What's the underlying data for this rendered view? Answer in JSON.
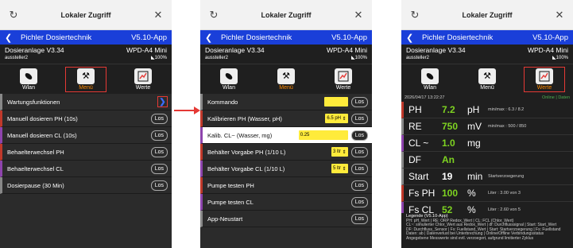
{
  "window": {
    "title": "Lokaler Zugriff"
  },
  "app": {
    "name": "Pichler Dosiertechnik",
    "version": "V5.10-App",
    "device": "Dosieranlage V3.34",
    "device_sub": "aussteller2",
    "model": "WPD-A4 Mini",
    "signal": "100%"
  },
  "nav": {
    "wlan": "Wlan",
    "menu": "Menü",
    "werte": "Werte"
  },
  "los": "Los",
  "screen1": {
    "items": [
      "Wartungsfunktionen",
      "Manuell dosieren PH (10s)",
      "Manuell dosieren CL (10s)",
      "Behaelterwechsel PH",
      "Behaelterwechsel CL",
      "Dosierpause (30 Min)"
    ]
  },
  "screen2": {
    "items": [
      "Kommando",
      "Kalibrieren PH (Wasser, pH)",
      "Kalib. CL~ (Wasser, mg)",
      "Behälter Vorgabe PH (1/10 L)",
      "Behälter Vorgabe CL (1/10 L)",
      "Pumpe testen PH",
      "Pumpe testen CL",
      "App-Neustart"
    ],
    "cal_ph": "6.5 pH",
    "cal_cl": "0.25",
    "vol_ph": "3 ltr",
    "vol_cl": "5 ltr"
  },
  "screen3": {
    "timestamp": "2026/04/17 13:22:27",
    "status": "Online | Daten",
    "rows": [
      {
        "name": "PH",
        "value": "7.2",
        "unit": "pH",
        "extra": "min/max : 6.3 / 8.2"
      },
      {
        "name": "RE",
        "value": "750",
        "unit": "mV",
        "extra": "min/max : 500 / 850"
      },
      {
        "name": "CL ~",
        "value": "1.0",
        "unit": "mg",
        "extra": ""
      },
      {
        "name": "DF",
        "value": "An",
        "unit": "",
        "extra": ""
      },
      {
        "name": "Start",
        "value": "19",
        "unit": "min",
        "extra": "Startverzoegerung"
      },
      {
        "name": "Fs PH",
        "value": "100",
        "unit": "%",
        "extra": "Liter : 3.00 von 3"
      },
      {
        "name": "Fs CL",
        "value": "52",
        "unit": "%",
        "extra": "Liter : 2.60 von 5"
      }
    ],
    "legend_title": "Legende (V5.10-App)",
    "legend_lines": [
      "PH: pH_Wert | RE: ORP Redox_Wert | CL: FCL (Chlor_Wert)",
      "CL~: simulierter Chlor_Wert aus Redox_Wert | df: Durchflusssignal | Start: Start_Wert",
      "DF: Durchfluss_Sensor | Fs: Fuellstand_Wert | Start: Startverzoegerung | Fs: Fuellstand",
      "Daten: ab | Datenverlust bei Unterbrechung | Online/Offline Verbindungsstatus",
      "Angegebene Messwerte sind evtl. verzoegert, aufgrund limitierter Zyklus"
    ]
  }
}
